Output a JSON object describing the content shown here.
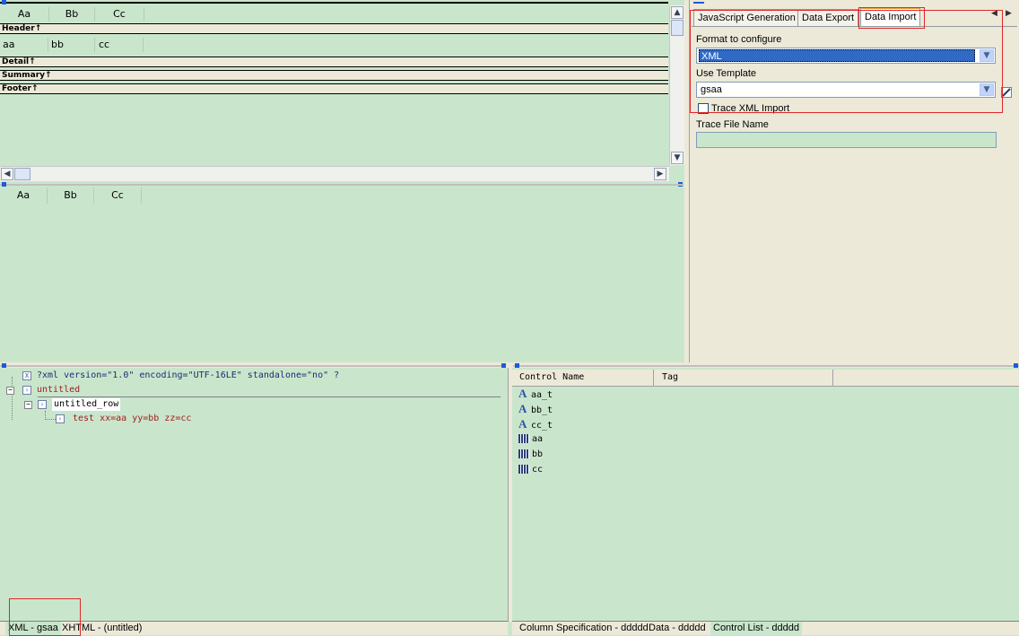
{
  "designer_top": {
    "columns": [
      "Aa",
      "Bb",
      "Cc"
    ],
    "bands": {
      "header": "Header↑",
      "detail": "Detail↑",
      "summary": "Summary↑",
      "footer": "Footer↑"
    },
    "detail_cells": [
      "aa",
      "bb",
      "cc"
    ]
  },
  "preview": {
    "columns": [
      "Aa",
      "Bb",
      "Cc"
    ]
  },
  "right_panel": {
    "tabs": [
      "JavaScript Generation",
      "Data Export",
      "Data Import"
    ],
    "active_tab": "Data Import",
    "format_label": "Format to configure",
    "format_value": "XML",
    "template_label": "Use Template",
    "template_value": "gsaa",
    "trace_checkbox_label": "Trace XML Import",
    "trace_file_label": "Trace File Name",
    "trace_file_value": ""
  },
  "xml_tree": {
    "declaration": "?xml version=\"1.0\" encoding=\"UTF-16LE\" standalone=\"no\" ?",
    "root": "untitled",
    "row": "untitled_row",
    "leaf": "test xx=aa yy=bb zz=cc"
  },
  "control_list": {
    "headers": [
      "Control Name",
      "Tag"
    ],
    "items": [
      {
        "name": "aa_t",
        "icon": "text-icon"
      },
      {
        "name": "bb_t",
        "icon": "text-icon"
      },
      {
        "name": "cc_t",
        "icon": "text-icon"
      },
      {
        "name": "aa",
        "icon": "field-icon"
      },
      {
        "name": "bb",
        "icon": "field-icon"
      },
      {
        "name": "cc",
        "icon": "field-icon"
      }
    ]
  },
  "bottom_tabs_left": [
    "XML - gsaa",
    "XHTML - (untitled)"
  ],
  "bottom_tabs_right": [
    "Column Specification - ddddd",
    "Data - ddddd",
    "Control List - ddddd"
  ],
  "colors": {
    "background": "#c9e6cc",
    "panel": "#ece9d8",
    "highlight": "#316ac5",
    "annotation": "#e0262a"
  }
}
